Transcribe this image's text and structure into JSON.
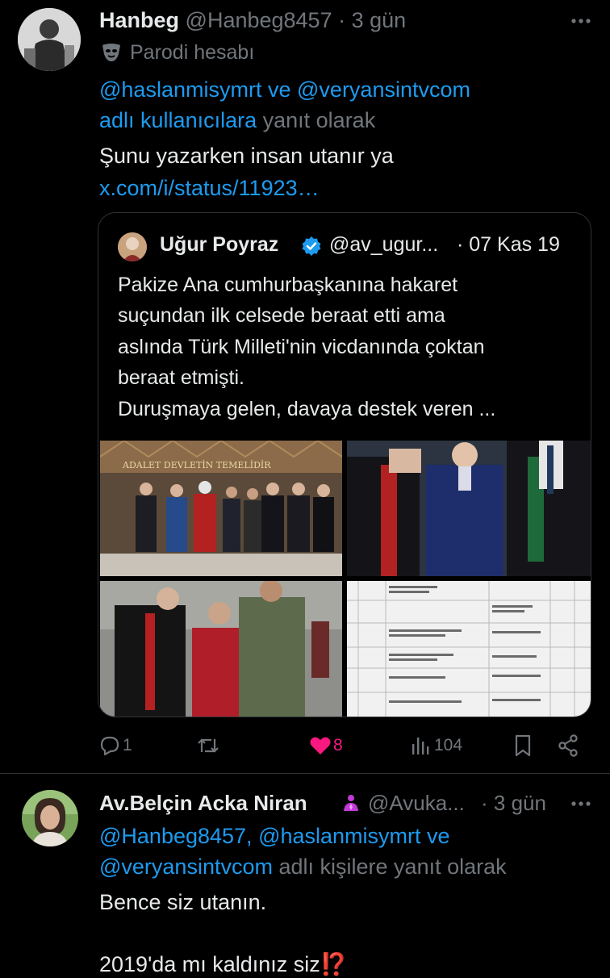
{
  "tweet1": {
    "display_name": "Hanbeg",
    "handle": "@Hanbeg8457",
    "sep": "·",
    "time": "3 gün",
    "parody_label": "Parodi hesabı",
    "reply_mention1": "@haslanmisymrt",
    "reply_and": "ve",
    "reply_mention2": "@veryansintvcom",
    "reply_line2_link": "adlı kullanıcılara",
    "reply_suffix": "yanıt olarak",
    "text": "Şunu yazarken insan utanır ya",
    "url": "x.com/i/status/11923…",
    "quote": {
      "display_name": "Uğur Poyraz",
      "handle": "@av_ugur...",
      "time": "· 07 Kas 19",
      "lines": [
        "Pakize Ana cumhurbaşkanına hakaret",
        "suçundan ilk celsede beraat etti ama",
        "aslında Türk Milleti'nin vicdanında çoktan",
        "beraat etmişti.",
        "Duruşmaya gelen, davaya destek veren ..."
      ],
      "photo1_sign": "ADALET DEVLETİN TEMELİDİR"
    },
    "actions": {
      "replies": "1",
      "retweets": "",
      "likes": "8",
      "views": "104"
    }
  },
  "tweet2": {
    "display_name": "Av.Belçin Acka Niran",
    "handle": "@Avuka...",
    "time": "· 3 gün",
    "reply_mention1": "@Hanbeg8457,",
    "reply_mention2": "@haslanmisymrt",
    "reply_and": "ve",
    "reply_mention3": "@veryansintvcom",
    "reply_suffix": "adlı kişilere yanıt olarak",
    "text_line1": "Bence siz utanın.",
    "text_line2": "2019'da mı kaldınız siz⁉️"
  },
  "colors": {
    "background": "#000000",
    "link": "#1d9bf0",
    "muted": "#71767b",
    "like": "#f91880",
    "verified": "#1d9bf0"
  }
}
